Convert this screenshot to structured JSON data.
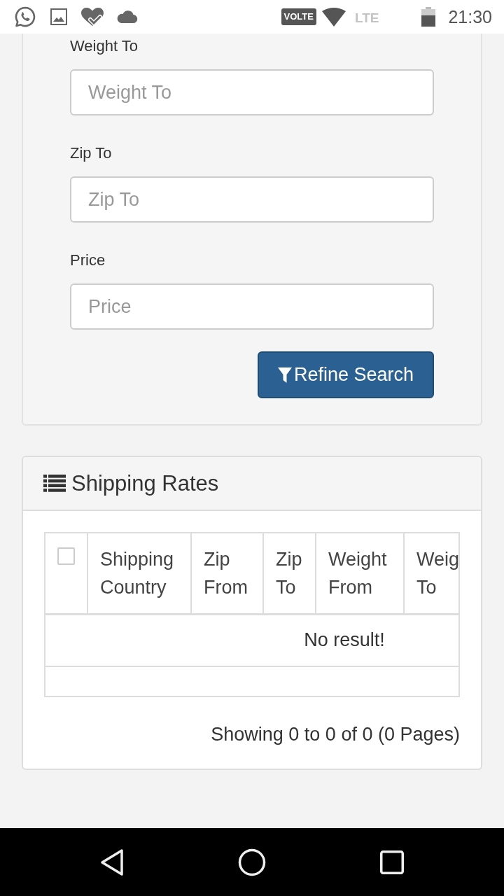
{
  "status_bar": {
    "network_badge": "VOLTE",
    "network_type": "LTE",
    "time": "21:30"
  },
  "filter_panel": {
    "fields": [
      {
        "label": "Weight To",
        "placeholder": "Weight To"
      },
      {
        "label": "Zip To",
        "placeholder": "Zip To"
      },
      {
        "label": "Price",
        "placeholder": "Price"
      }
    ],
    "button": "Refine Search"
  },
  "shipping_rates": {
    "title": "Shipping Rates",
    "table": {
      "select_all": {
        "checked": false
      },
      "columns": [
        "Shipping Country",
        "Zip From",
        "Zip To",
        "Weight From",
        "Weig To"
      ],
      "empty_message": "No result!"
    },
    "pagination": "Showing 0 to 0 of 0 (0 Pages)"
  }
}
